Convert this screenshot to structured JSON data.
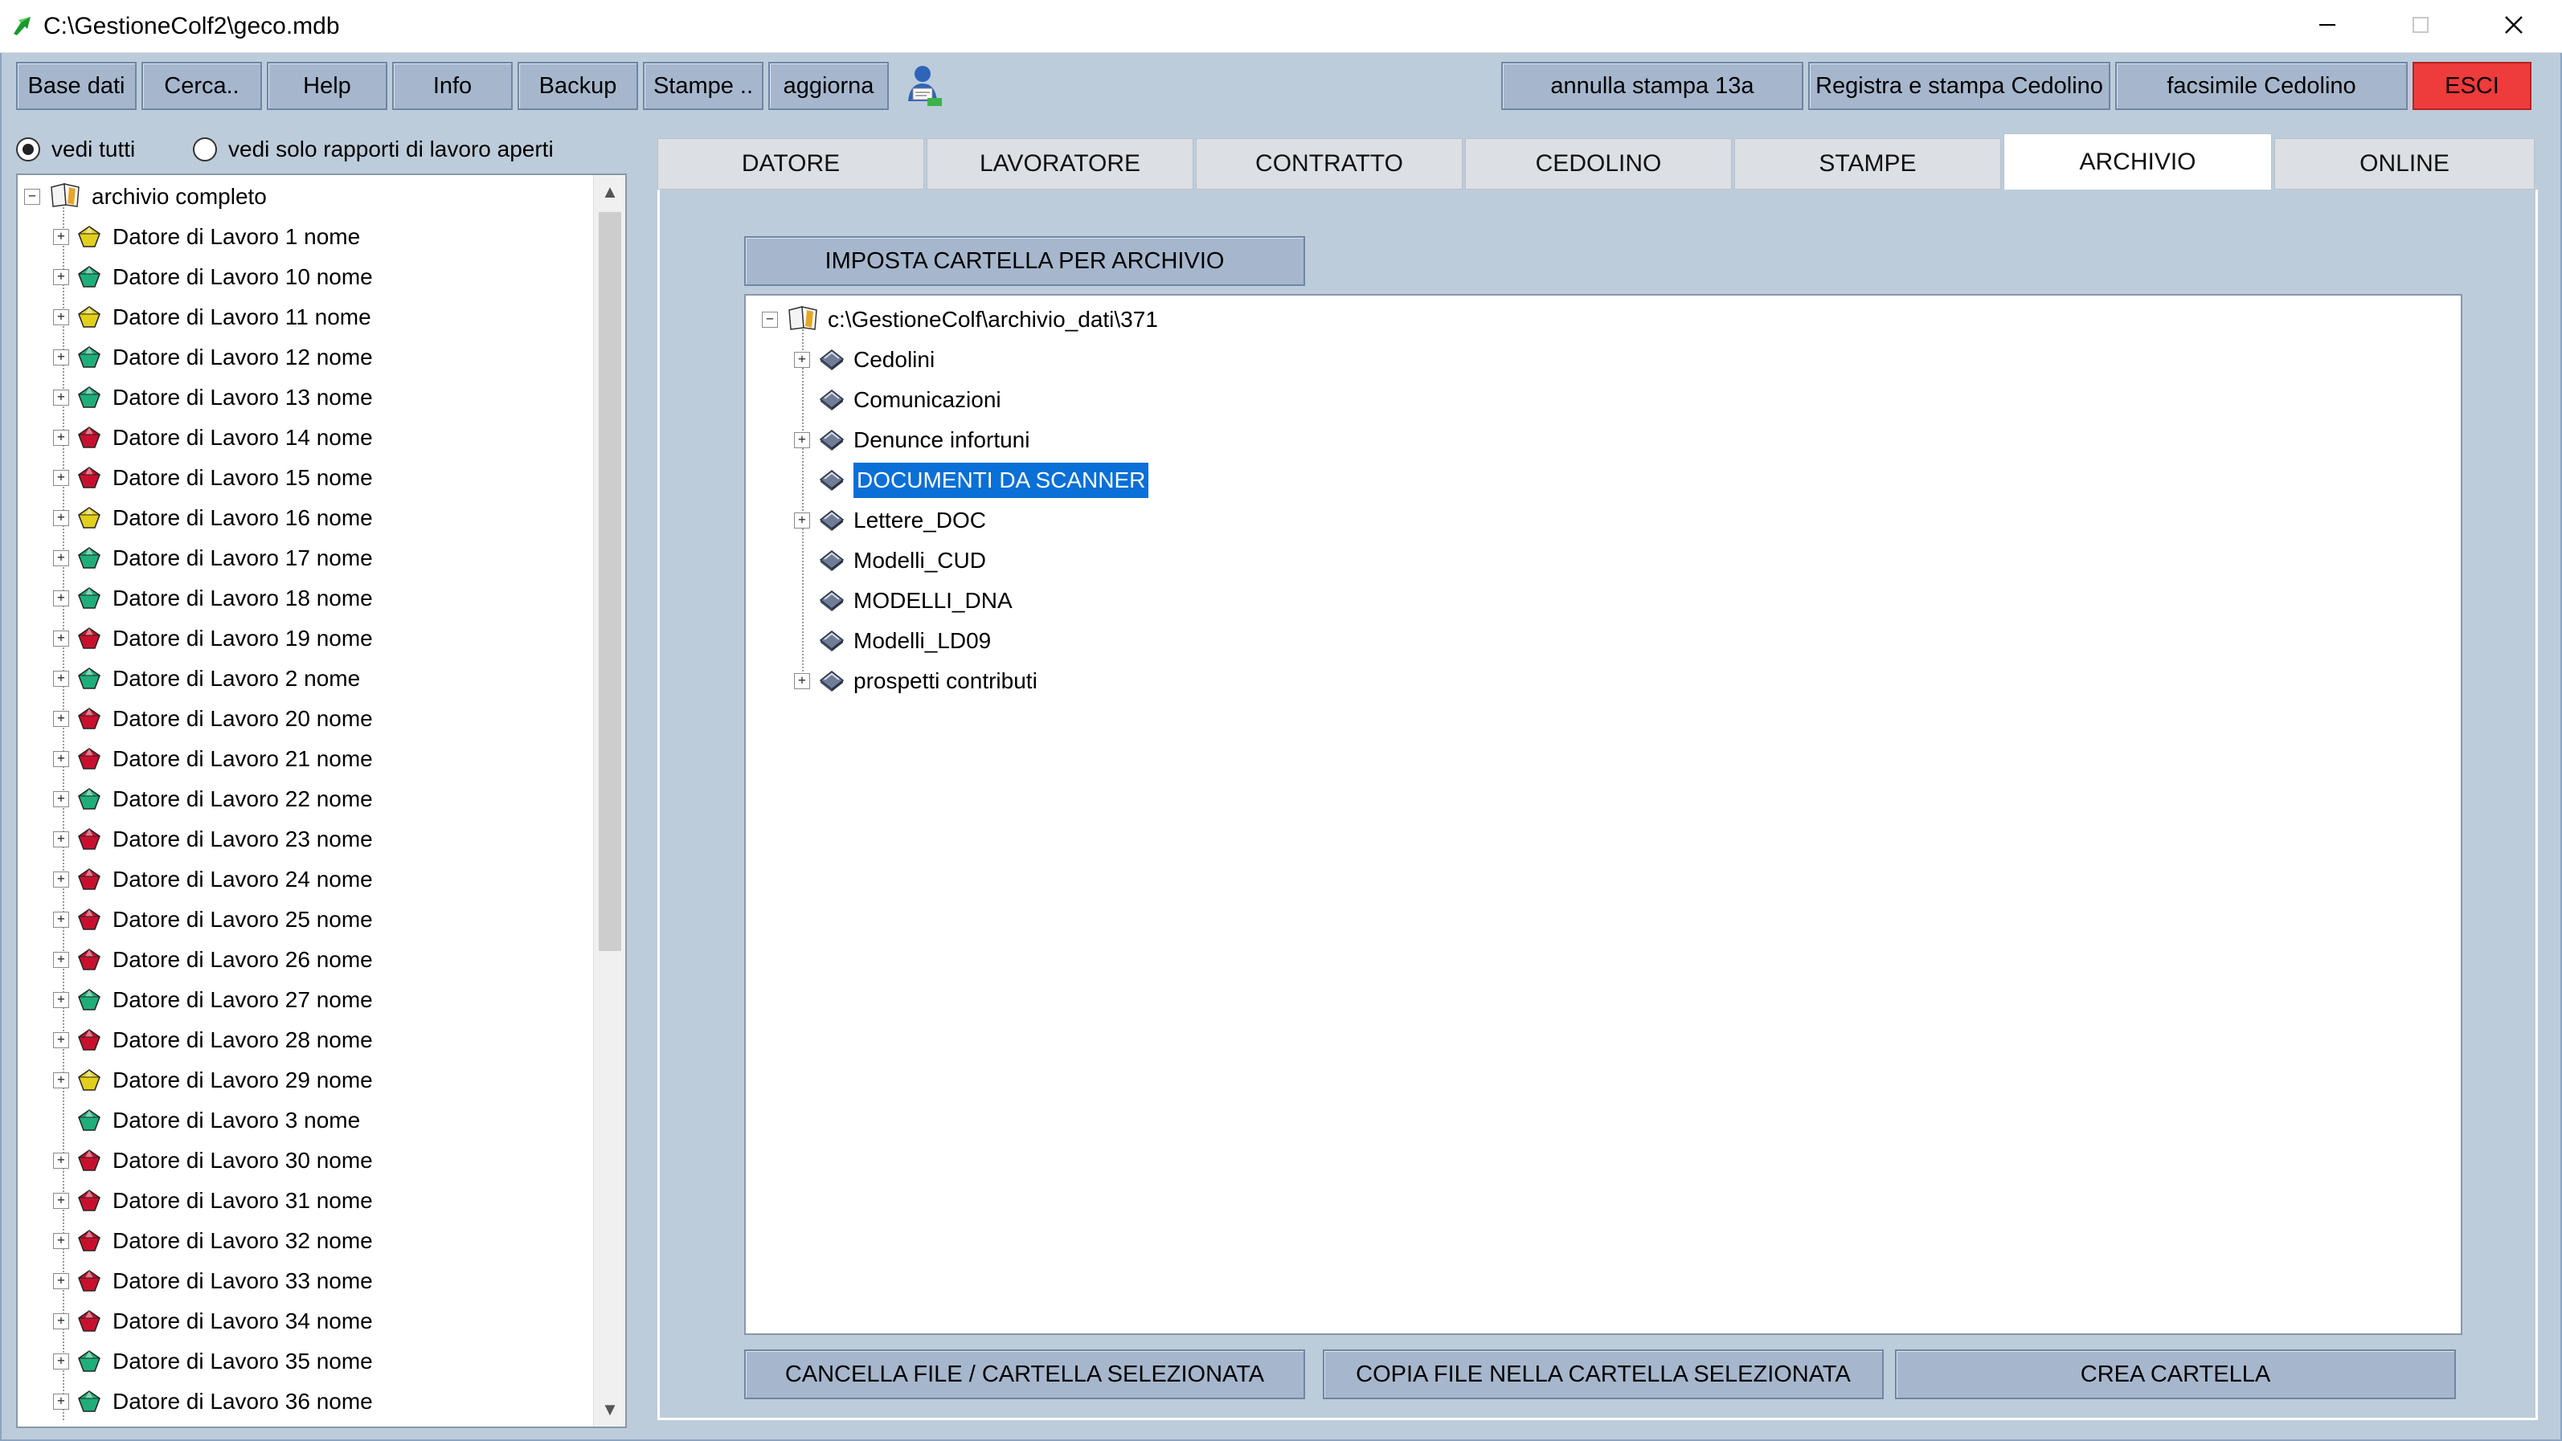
{
  "window": {
    "title": "C:\\GestioneColf2\\geco.mdb"
  },
  "toolbar": {
    "base_dati": "Base dati",
    "cerca": "Cerca..",
    "help": "Help",
    "info": "Info",
    "backup": "Backup",
    "stampe": "Stampe ..",
    "aggiorna": "aggiorna",
    "annulla": "annulla stampa 13a",
    "registra": "Registra e stampa Cedolino",
    "facsimile": "facsimile Cedolino",
    "esci": "ESCI"
  },
  "filter": {
    "vedi_tutti": "vedi tutti",
    "vedi_aperti": "vedi solo rapporti di lavoro aperti",
    "selected": "vedi_tutti"
  },
  "left_tree": {
    "root": "archivio completo",
    "items": [
      {
        "label": "Datore di Lavoro 1 nome",
        "color": "yellow",
        "expandable": true
      },
      {
        "label": "Datore di Lavoro 10 nome",
        "color": "green",
        "expandable": true
      },
      {
        "label": "Datore di Lavoro 11 nome",
        "color": "yellow",
        "expandable": true
      },
      {
        "label": "Datore di Lavoro 12 nome",
        "color": "green",
        "expandable": true
      },
      {
        "label": "Datore di Lavoro 13 nome",
        "color": "green",
        "expandable": true
      },
      {
        "label": "Datore di Lavoro 14 nome",
        "color": "red",
        "expandable": true
      },
      {
        "label": "Datore di Lavoro 15 nome",
        "color": "red",
        "expandable": true
      },
      {
        "label": "Datore di Lavoro 16 nome",
        "color": "yellow",
        "expandable": true
      },
      {
        "label": "Datore di Lavoro 17 nome",
        "color": "green",
        "expandable": true
      },
      {
        "label": "Datore di Lavoro 18 nome",
        "color": "green",
        "expandable": true
      },
      {
        "label": "Datore di Lavoro 19 nome",
        "color": "red",
        "expandable": true
      },
      {
        "label": "Datore di Lavoro 2 nome",
        "color": "green",
        "expandable": true
      },
      {
        "label": "Datore di Lavoro 20 nome",
        "color": "red",
        "expandable": true
      },
      {
        "label": "Datore di Lavoro 21 nome",
        "color": "red",
        "expandable": true
      },
      {
        "label": "Datore di Lavoro 22 nome",
        "color": "green",
        "expandable": true
      },
      {
        "label": "Datore di Lavoro 23 nome",
        "color": "red",
        "expandable": true
      },
      {
        "label": "Datore di Lavoro 24 nome",
        "color": "red",
        "expandable": true
      },
      {
        "label": "Datore di Lavoro 25 nome",
        "color": "red",
        "expandable": true
      },
      {
        "label": "Datore di Lavoro 26 nome",
        "color": "red",
        "expandable": true
      },
      {
        "label": "Datore di Lavoro 27 nome",
        "color": "green",
        "expandable": true
      },
      {
        "label": "Datore di Lavoro 28 nome",
        "color": "red",
        "expandable": true
      },
      {
        "label": "Datore di Lavoro 29 nome",
        "color": "yellow",
        "expandable": true
      },
      {
        "label": "Datore di Lavoro 3 nome",
        "color": "green",
        "expandable": false
      },
      {
        "label": "Datore di Lavoro 30 nome",
        "color": "red",
        "expandable": true
      },
      {
        "label": "Datore di Lavoro 31 nome",
        "color": "red",
        "expandable": true
      },
      {
        "label": "Datore di Lavoro 32 nome",
        "color": "red",
        "expandable": true
      },
      {
        "label": "Datore di Lavoro 33 nome",
        "color": "red",
        "expandable": true
      },
      {
        "label": "Datore di Lavoro 34 nome",
        "color": "red",
        "expandable": true
      },
      {
        "label": "Datore di Lavoro 35 nome",
        "color": "green",
        "expandable": true
      },
      {
        "label": "Datore di Lavoro 36 nome",
        "color": "green",
        "expandable": true
      }
    ]
  },
  "tabs": [
    {
      "label": "DATORE",
      "active": false
    },
    {
      "label": "LAVORATORE",
      "active": false
    },
    {
      "label": "CONTRATTO",
      "active": false
    },
    {
      "label": "CEDOLINO",
      "active": false
    },
    {
      "label": "STAMPE",
      "active": false
    },
    {
      "label": "ARCHIVIO",
      "active": true
    },
    {
      "label": "ONLINE",
      "active": false
    }
  ],
  "archivio": {
    "imposta_cartella": "IMPOSTA CARTELLA PER ARCHIVIO",
    "root_path": "c:\\GestioneColf\\archivio_dati\\371",
    "folders": [
      {
        "label": "Cedolini",
        "expandable": true,
        "selected": false
      },
      {
        "label": "Comunicazioni",
        "expandable": false,
        "selected": false
      },
      {
        "label": "Denunce infortuni",
        "expandable": true,
        "selected": false
      },
      {
        "label": "DOCUMENTI DA SCANNER",
        "expandable": false,
        "selected": true
      },
      {
        "label": "Lettere_DOC",
        "expandable": true,
        "selected": false
      },
      {
        "label": "Modelli_CUD",
        "expandable": false,
        "selected": false
      },
      {
        "label": "MODELLI_DNA",
        "expandable": false,
        "selected": false
      },
      {
        "label": "Modelli_LD09",
        "expandable": false,
        "selected": false
      },
      {
        "label": "prospetti contributi",
        "expandable": true,
        "selected": false
      }
    ],
    "cancella": "CANCELLA   FILE / CARTELLA  SELEZIONATA",
    "copia": "COPIA FILE NELLA CARTELLA SELEZIONATA",
    "crea": "CREA CARTELLA"
  },
  "colors": {
    "background": "#bdccda",
    "button": "#a6b7cd",
    "esci": "#ee3b3b",
    "selection": "#0a6fd6",
    "gem_yellow": "#e2cf1c",
    "gem_green": "#1fae7a",
    "gem_red": "#c8102e"
  },
  "icons": {
    "app": "green-arrow-icon",
    "toolbar_user": "user-wizard-icon",
    "root_folder": "open-book-icon",
    "folder": "diamond-folder-icon",
    "employer": "gem-icon"
  }
}
